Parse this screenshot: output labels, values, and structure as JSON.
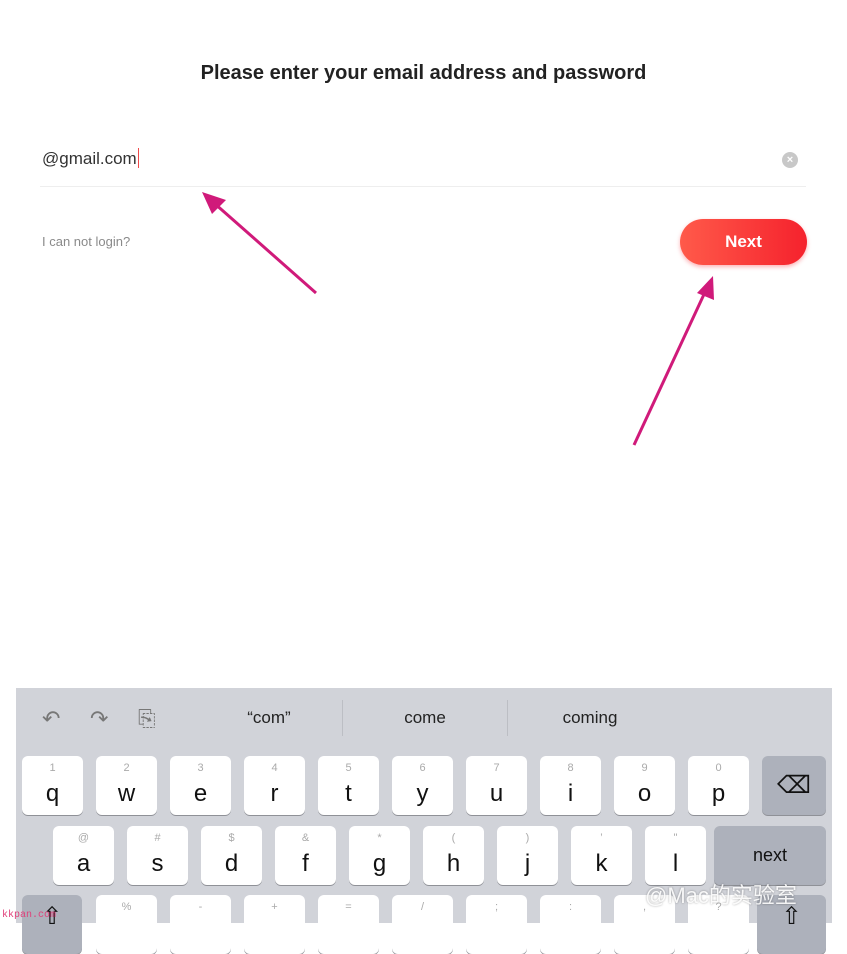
{
  "header": {
    "title": "Please enter your email address and password"
  },
  "form": {
    "email_value": "@gmail.com",
    "clear_icon": "clear-circle-icon",
    "forgot_link": "I can not login?",
    "next_button": "Next",
    "accent": "#f5222d"
  },
  "annotations": {
    "arrow_color": "#d01a7a"
  },
  "keyboard": {
    "toolbar": {
      "undo": "↶",
      "redo": "↷",
      "paste": "⎘"
    },
    "suggestions": [
      "“com”",
      "come",
      "coming"
    ],
    "row1": [
      {
        "h": "1",
        "c": "q"
      },
      {
        "h": "2",
        "c": "w"
      },
      {
        "h": "3",
        "c": "e"
      },
      {
        "h": "4",
        "c": "r"
      },
      {
        "h": "5",
        "c": "t"
      },
      {
        "h": "6",
        "c": "y"
      },
      {
        "h": "7",
        "c": "u"
      },
      {
        "h": "8",
        "c": "i"
      },
      {
        "h": "9",
        "c": "o"
      },
      {
        "h": "0",
        "c": "p"
      }
    ],
    "row2": [
      {
        "h": "@",
        "c": "a"
      },
      {
        "h": "#",
        "c": "s"
      },
      {
        "h": "$",
        "c": "d"
      },
      {
        "h": "&",
        "c": "f"
      },
      {
        "h": "*",
        "c": "g"
      },
      {
        "h": "(",
        "c": "h"
      },
      {
        "h": ")",
        "c": "j"
      },
      {
        "h": "’",
        "c": "k"
      },
      {
        "h": "\"",
        "c": "l"
      }
    ],
    "row3": [
      {
        "h": "%",
        "c": ""
      },
      {
        "h": "-",
        "c": ""
      },
      {
        "h": "+",
        "c": ""
      },
      {
        "h": "=",
        "c": ""
      },
      {
        "h": "/",
        "c": ""
      },
      {
        "h": ";",
        "c": ""
      },
      {
        "h": ":",
        "c": ""
      },
      {
        "h": ",",
        "c": ""
      },
      {
        "h": "?",
        "c": ""
      }
    ],
    "delete_icon": "⌫",
    "next_key": "next",
    "shift_icon": "⇧"
  },
  "watermarks": {
    "main": "@Mac的实验室",
    "site": "kkpan.com"
  }
}
